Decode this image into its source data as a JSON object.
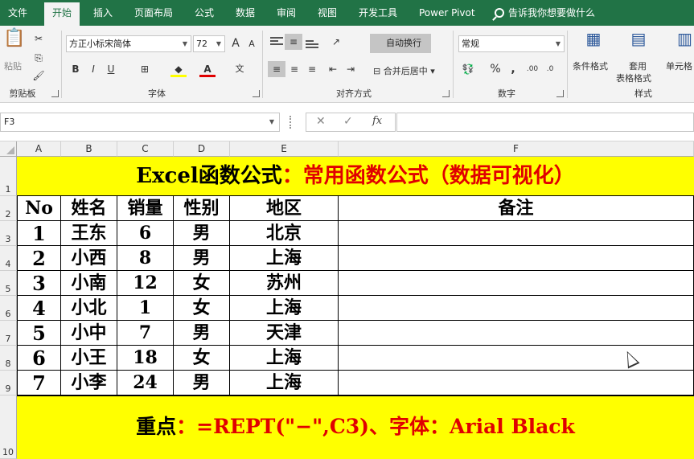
{
  "tabs": [
    "文件",
    "开始",
    "插入",
    "页面布局",
    "公式",
    "数据",
    "审阅",
    "视图",
    "开发工具",
    "Power Pivot"
  ],
  "tell_me": "告诉我你想要做什么",
  "ribbon": {
    "clipboard": {
      "paste": "粘贴",
      "label": "剪贴板"
    },
    "font": {
      "name": "方正小标宋简体",
      "size": "72",
      "grow": "A",
      "shrink": "A",
      "bold": "B",
      "italic": "I",
      "underline": "U",
      "label": "字体"
    },
    "alignment": {
      "wrap": "自动换行",
      "merge": "合并后居中",
      "label": "对齐方式"
    },
    "number": {
      "format": "常规",
      "percent": "%",
      "comma": ",",
      "label": "数字"
    },
    "styles": {
      "cond_format": "条件格式",
      "table_format_1": "套用",
      "table_format_2": "表格格式",
      "cell_styles": "单元格",
      "label": "样式"
    }
  },
  "formula_bar": {
    "name_box": "F3",
    "fx": "fx",
    "value": ""
  },
  "columns": [
    "A",
    "B",
    "C",
    "D",
    "E",
    "F"
  ],
  "rows": [
    "1",
    "2",
    "3",
    "4",
    "5",
    "6",
    "7",
    "8",
    "9",
    "10"
  ],
  "sheet": {
    "title_black": "Excel函数公式",
    "title_red": "：常用函数公式（数据可视化）",
    "headers": [
      "No",
      "姓名",
      "销量",
      "性别",
      "地区",
      "备注"
    ],
    "records": [
      [
        "1",
        "王东",
        "6",
        "男",
        "北京",
        ""
      ],
      [
        "2",
        "小西",
        "8",
        "男",
        "上海",
        ""
      ],
      [
        "3",
        "小南",
        "12",
        "女",
        "苏州",
        ""
      ],
      [
        "4",
        "小北",
        "1",
        "女",
        "上海",
        ""
      ],
      [
        "5",
        "小中",
        "7",
        "男",
        "天津",
        ""
      ],
      [
        "6",
        "小王",
        "18",
        "女",
        "上海",
        ""
      ],
      [
        "7",
        "小李",
        "24",
        "男",
        "上海",
        ""
      ]
    ],
    "footer_black_1": "重点",
    "footer_red_1": "：=REPT(\"−\",C3)、字体：Arial Black"
  }
}
